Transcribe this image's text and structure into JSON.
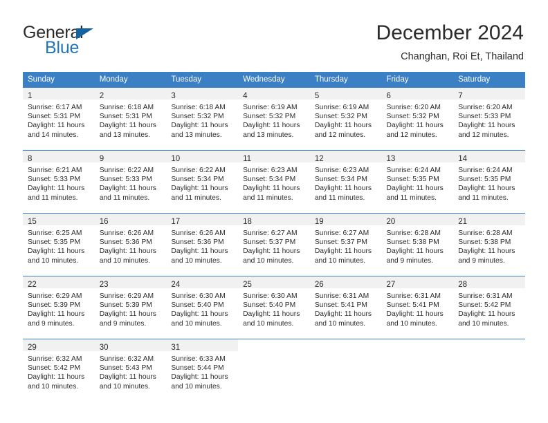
{
  "brand": {
    "name_part1": "General",
    "name_part2": "Blue",
    "flag_icon": "triangle-flag-icon"
  },
  "header": {
    "title": "December 2024",
    "location": "Changhan, Roi Et, Thailand"
  },
  "colors": {
    "header_blue": "#3b7fc4",
    "brand_blue": "#1f76bc",
    "flag_blue": "#14639e",
    "daynum_band": "#f1f1f1",
    "text": "#2b2b2b"
  },
  "weekday_headers": [
    "Sunday",
    "Monday",
    "Tuesday",
    "Wednesday",
    "Thursday",
    "Friday",
    "Saturday"
  ],
  "weeks": [
    [
      {
        "day": "1",
        "sunrise": "Sunrise: 6:17 AM",
        "sunset": "Sunset: 5:31 PM",
        "daylight1": "Daylight: 11 hours",
        "daylight2": "and 14 minutes."
      },
      {
        "day": "2",
        "sunrise": "Sunrise: 6:18 AM",
        "sunset": "Sunset: 5:31 PM",
        "daylight1": "Daylight: 11 hours",
        "daylight2": "and 13 minutes."
      },
      {
        "day": "3",
        "sunrise": "Sunrise: 6:18 AM",
        "sunset": "Sunset: 5:32 PM",
        "daylight1": "Daylight: 11 hours",
        "daylight2": "and 13 minutes."
      },
      {
        "day": "4",
        "sunrise": "Sunrise: 6:19 AM",
        "sunset": "Sunset: 5:32 PM",
        "daylight1": "Daylight: 11 hours",
        "daylight2": "and 13 minutes."
      },
      {
        "day": "5",
        "sunrise": "Sunrise: 6:19 AM",
        "sunset": "Sunset: 5:32 PM",
        "daylight1": "Daylight: 11 hours",
        "daylight2": "and 12 minutes."
      },
      {
        "day": "6",
        "sunrise": "Sunrise: 6:20 AM",
        "sunset": "Sunset: 5:32 PM",
        "daylight1": "Daylight: 11 hours",
        "daylight2": "and 12 minutes."
      },
      {
        "day": "7",
        "sunrise": "Sunrise: 6:20 AM",
        "sunset": "Sunset: 5:33 PM",
        "daylight1": "Daylight: 11 hours",
        "daylight2": "and 12 minutes."
      }
    ],
    [
      {
        "day": "8",
        "sunrise": "Sunrise: 6:21 AM",
        "sunset": "Sunset: 5:33 PM",
        "daylight1": "Daylight: 11 hours",
        "daylight2": "and 11 minutes."
      },
      {
        "day": "9",
        "sunrise": "Sunrise: 6:22 AM",
        "sunset": "Sunset: 5:33 PM",
        "daylight1": "Daylight: 11 hours",
        "daylight2": "and 11 minutes."
      },
      {
        "day": "10",
        "sunrise": "Sunrise: 6:22 AM",
        "sunset": "Sunset: 5:34 PM",
        "daylight1": "Daylight: 11 hours",
        "daylight2": "and 11 minutes."
      },
      {
        "day": "11",
        "sunrise": "Sunrise: 6:23 AM",
        "sunset": "Sunset: 5:34 PM",
        "daylight1": "Daylight: 11 hours",
        "daylight2": "and 11 minutes."
      },
      {
        "day": "12",
        "sunrise": "Sunrise: 6:23 AM",
        "sunset": "Sunset: 5:34 PM",
        "daylight1": "Daylight: 11 hours",
        "daylight2": "and 11 minutes."
      },
      {
        "day": "13",
        "sunrise": "Sunrise: 6:24 AM",
        "sunset": "Sunset: 5:35 PM",
        "daylight1": "Daylight: 11 hours",
        "daylight2": "and 11 minutes."
      },
      {
        "day": "14",
        "sunrise": "Sunrise: 6:24 AM",
        "sunset": "Sunset: 5:35 PM",
        "daylight1": "Daylight: 11 hours",
        "daylight2": "and 11 minutes."
      }
    ],
    [
      {
        "day": "15",
        "sunrise": "Sunrise: 6:25 AM",
        "sunset": "Sunset: 5:35 PM",
        "daylight1": "Daylight: 11 hours",
        "daylight2": "and 10 minutes."
      },
      {
        "day": "16",
        "sunrise": "Sunrise: 6:26 AM",
        "sunset": "Sunset: 5:36 PM",
        "daylight1": "Daylight: 11 hours",
        "daylight2": "and 10 minutes."
      },
      {
        "day": "17",
        "sunrise": "Sunrise: 6:26 AM",
        "sunset": "Sunset: 5:36 PM",
        "daylight1": "Daylight: 11 hours",
        "daylight2": "and 10 minutes."
      },
      {
        "day": "18",
        "sunrise": "Sunrise: 6:27 AM",
        "sunset": "Sunset: 5:37 PM",
        "daylight1": "Daylight: 11 hours",
        "daylight2": "and 10 minutes."
      },
      {
        "day": "19",
        "sunrise": "Sunrise: 6:27 AM",
        "sunset": "Sunset: 5:37 PM",
        "daylight1": "Daylight: 11 hours",
        "daylight2": "and 10 minutes."
      },
      {
        "day": "20",
        "sunrise": "Sunrise: 6:28 AM",
        "sunset": "Sunset: 5:38 PM",
        "daylight1": "Daylight: 11 hours",
        "daylight2": "and 9 minutes."
      },
      {
        "day": "21",
        "sunrise": "Sunrise: 6:28 AM",
        "sunset": "Sunset: 5:38 PM",
        "daylight1": "Daylight: 11 hours",
        "daylight2": "and 9 minutes."
      }
    ],
    [
      {
        "day": "22",
        "sunrise": "Sunrise: 6:29 AM",
        "sunset": "Sunset: 5:39 PM",
        "daylight1": "Daylight: 11 hours",
        "daylight2": "and 9 minutes."
      },
      {
        "day": "23",
        "sunrise": "Sunrise: 6:29 AM",
        "sunset": "Sunset: 5:39 PM",
        "daylight1": "Daylight: 11 hours",
        "daylight2": "and 9 minutes."
      },
      {
        "day": "24",
        "sunrise": "Sunrise: 6:30 AM",
        "sunset": "Sunset: 5:40 PM",
        "daylight1": "Daylight: 11 hours",
        "daylight2": "and 10 minutes."
      },
      {
        "day": "25",
        "sunrise": "Sunrise: 6:30 AM",
        "sunset": "Sunset: 5:40 PM",
        "daylight1": "Daylight: 11 hours",
        "daylight2": "and 10 minutes."
      },
      {
        "day": "26",
        "sunrise": "Sunrise: 6:31 AM",
        "sunset": "Sunset: 5:41 PM",
        "daylight1": "Daylight: 11 hours",
        "daylight2": "and 10 minutes."
      },
      {
        "day": "27",
        "sunrise": "Sunrise: 6:31 AM",
        "sunset": "Sunset: 5:41 PM",
        "daylight1": "Daylight: 11 hours",
        "daylight2": "and 10 minutes."
      },
      {
        "day": "28",
        "sunrise": "Sunrise: 6:31 AM",
        "sunset": "Sunset: 5:42 PM",
        "daylight1": "Daylight: 11 hours",
        "daylight2": "and 10 minutes."
      }
    ],
    [
      {
        "day": "29",
        "sunrise": "Sunrise: 6:32 AM",
        "sunset": "Sunset: 5:42 PM",
        "daylight1": "Daylight: 11 hours",
        "daylight2": "and 10 minutes."
      },
      {
        "day": "30",
        "sunrise": "Sunrise: 6:32 AM",
        "sunset": "Sunset: 5:43 PM",
        "daylight1": "Daylight: 11 hours",
        "daylight2": "and 10 minutes."
      },
      {
        "day": "31",
        "sunrise": "Sunrise: 6:33 AM",
        "sunset": "Sunset: 5:44 PM",
        "daylight1": "Daylight: 11 hours",
        "daylight2": "and 10 minutes."
      },
      null,
      null,
      null,
      null
    ]
  ]
}
